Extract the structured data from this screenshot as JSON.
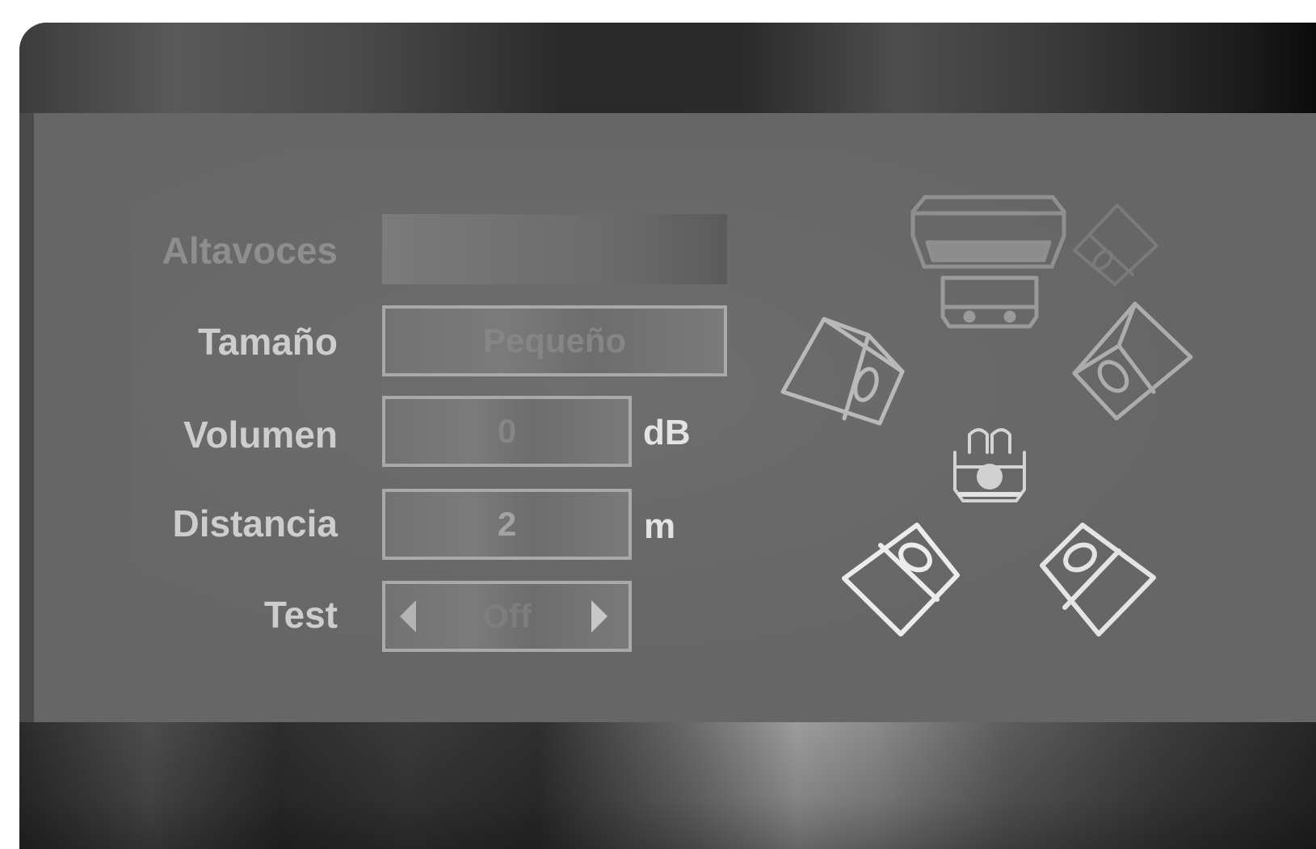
{
  "menu": {
    "speakers_label": "Altavoces",
    "speakers_value": "",
    "size_label": "Tamaño",
    "size_value": "Pequeño",
    "volume_label": "Volumen",
    "volume_value": "0",
    "volume_unit": "dB",
    "distance_label": "Distancia",
    "distance_value": "2",
    "distance_unit": "m",
    "test_label": "Test",
    "test_value": "Off"
  },
  "icons": {
    "left_arrow": "caret-left-icon",
    "right_arrow": "caret-right-icon",
    "speaker_layout": "speaker-layout-diagram"
  }
}
